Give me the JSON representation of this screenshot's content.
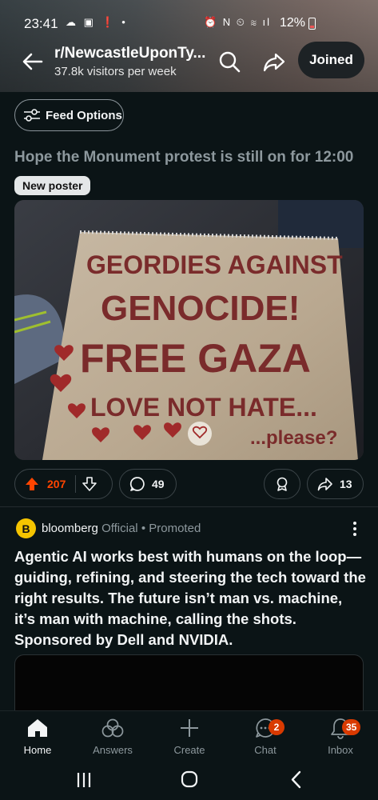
{
  "status": {
    "time": "23:41",
    "battery": "12%"
  },
  "header": {
    "subreddit": "r/NewcastleUponTy...",
    "visitors": "37.8k visitors per week",
    "joined_label": "Joined"
  },
  "feed": {
    "options_label": "Feed Options"
  },
  "post": {
    "title": "Hope the Monument protest is still on for 12:00",
    "flair": "New poster",
    "sign_lines": [
      "GEORDIES AGAINST",
      "GENOCIDE!",
      "FREE GAZA",
      "LOVE NOT HATE...",
      "...please?"
    ],
    "upvotes": "207",
    "comments": "49",
    "shares": "13"
  },
  "ad": {
    "avatar_letter": "B",
    "advertiser": "bloomberg",
    "official": "Official",
    "promoted": "Promoted",
    "text": "Agentic AI works best with humans on the loop—guiding, refining, and steering the tech toward the right results. The future isn’t man vs. machine, it’s man with machine, calling the shots. Sponsored by Dell and NVIDIA."
  },
  "nav": {
    "home": "Home",
    "answers": "Answers",
    "create": "Create",
    "chat": "Chat",
    "chat_badge": "2",
    "inbox": "Inbox",
    "inbox_badge": "35"
  },
  "colors": {
    "background": "#0b1416",
    "upvote_accent": "#ff4500",
    "badge": "#d93a00",
    "advertiser_avatar": "#f5c400"
  }
}
